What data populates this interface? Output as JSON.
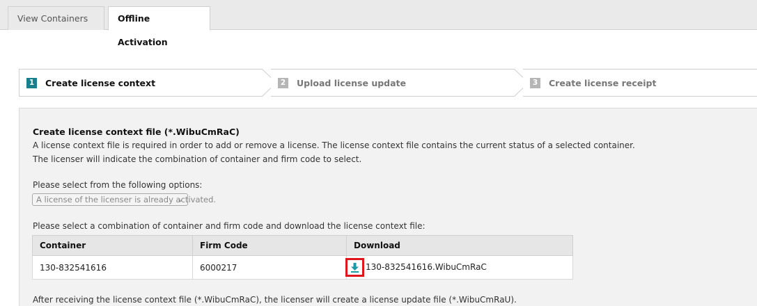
{
  "tabs": {
    "view_containers": "View Containers",
    "offline_activation": "Offline Activation"
  },
  "wizard": {
    "steps": [
      {
        "num": "1",
        "label": "Create license context"
      },
      {
        "num": "2",
        "label": "Upload license update"
      },
      {
        "num": "3",
        "label": "Create license receipt"
      }
    ]
  },
  "panel": {
    "title": "Create license context file (*.WibuCmRaC)",
    "text1": "A license context file is required in order to add or remove a license. The license context file contains the current status of a selected container.",
    "text2": "The licenser will indicate the combination of container and firm code to select.",
    "select_label": "Please select from the following options:",
    "select_value": "A license of the licenser is already activated.",
    "combo_label": "Please select a combination of container and firm code and download the license context file:",
    "after_text": "After receiving the license context file (*.WibuCmRaC), the licenser will create a license update file (*.WibuCmRaU)."
  },
  "table": {
    "headers": [
      "Container",
      "Firm Code",
      "Download"
    ],
    "rows": [
      {
        "container": "130-832541616",
        "firm_code": "6000217",
        "download": "130-832541616.WibuCmRaC"
      }
    ]
  },
  "colors": {
    "accent": "#1a7f8c",
    "highlight": "#e0161d"
  },
  "icons": {
    "download": "download-icon",
    "dropdown": "chevron-down-icon"
  }
}
